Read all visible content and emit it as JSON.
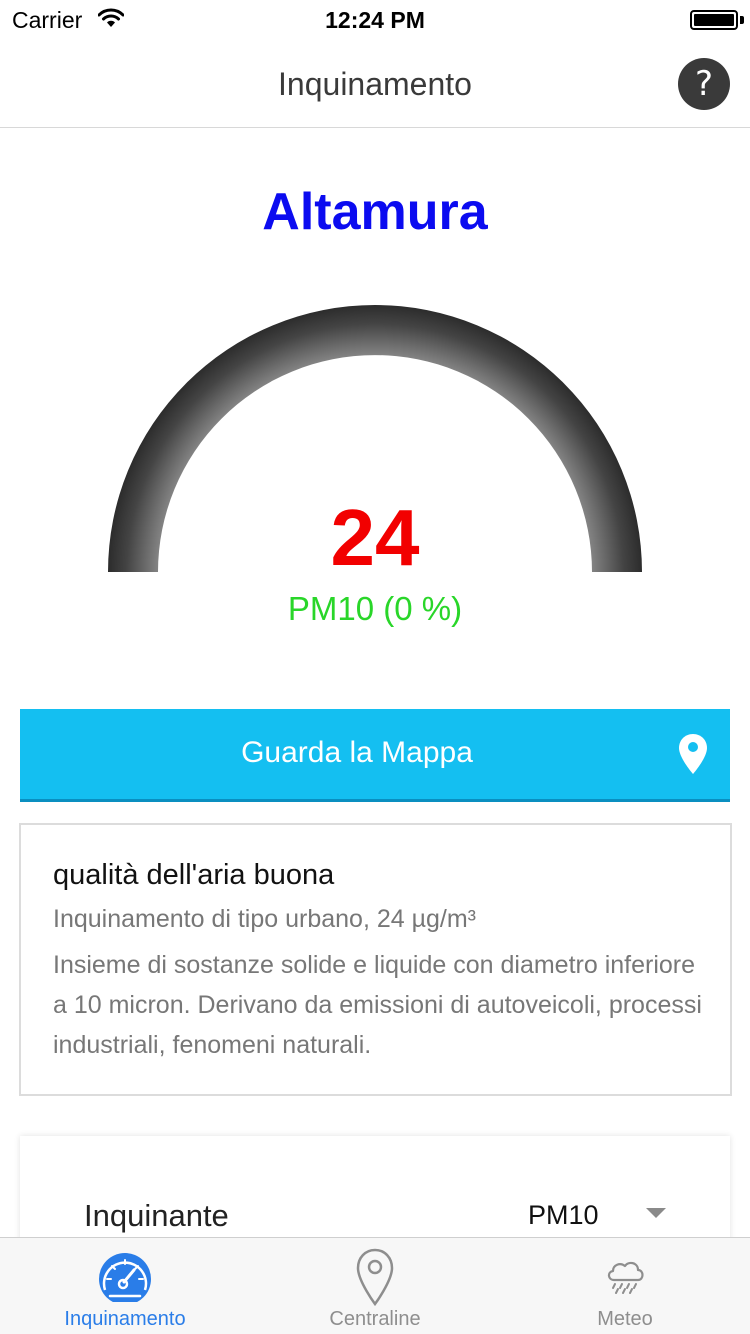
{
  "status_bar": {
    "carrier": "Carrier",
    "time": "12:24 PM",
    "battery_level": 1.0
  },
  "nav": {
    "title": "Inquinamento",
    "help_label": "?"
  },
  "city": "Altamura",
  "gauge": {
    "value": "24",
    "label": "PM10 (0 %)",
    "fill_fraction": 0.0,
    "colors": {
      "value": "#f20000",
      "label": "#29d629",
      "track": "#555555"
    }
  },
  "map_button": {
    "label": "Guarda la Mappa",
    "icon": "map-pin-icon",
    "color": "#14bff1"
  },
  "info": {
    "title": "qualità dell'aria buona",
    "subtitle": "Inquinamento di tipo urbano, 24 µg/m³",
    "description": "Insieme di sostanze solide e liquide con diametro inferiore a 10 micron. Derivano da emissioni di autoveicoli, processi industriali, fenomeni naturali."
  },
  "settings": {
    "pollutant_label": "Inquinante",
    "pollutant_value": "PM10"
  },
  "tabs": [
    {
      "label": "Inquinamento",
      "icon": "speedometer-icon",
      "active": true
    },
    {
      "label": "Centraline",
      "icon": "location-pin-icon",
      "active": false
    },
    {
      "label": "Meteo",
      "icon": "rain-cloud-icon",
      "active": false
    }
  ],
  "colors": {
    "accent": "#2a7de8",
    "city": "#0b0bf0"
  }
}
